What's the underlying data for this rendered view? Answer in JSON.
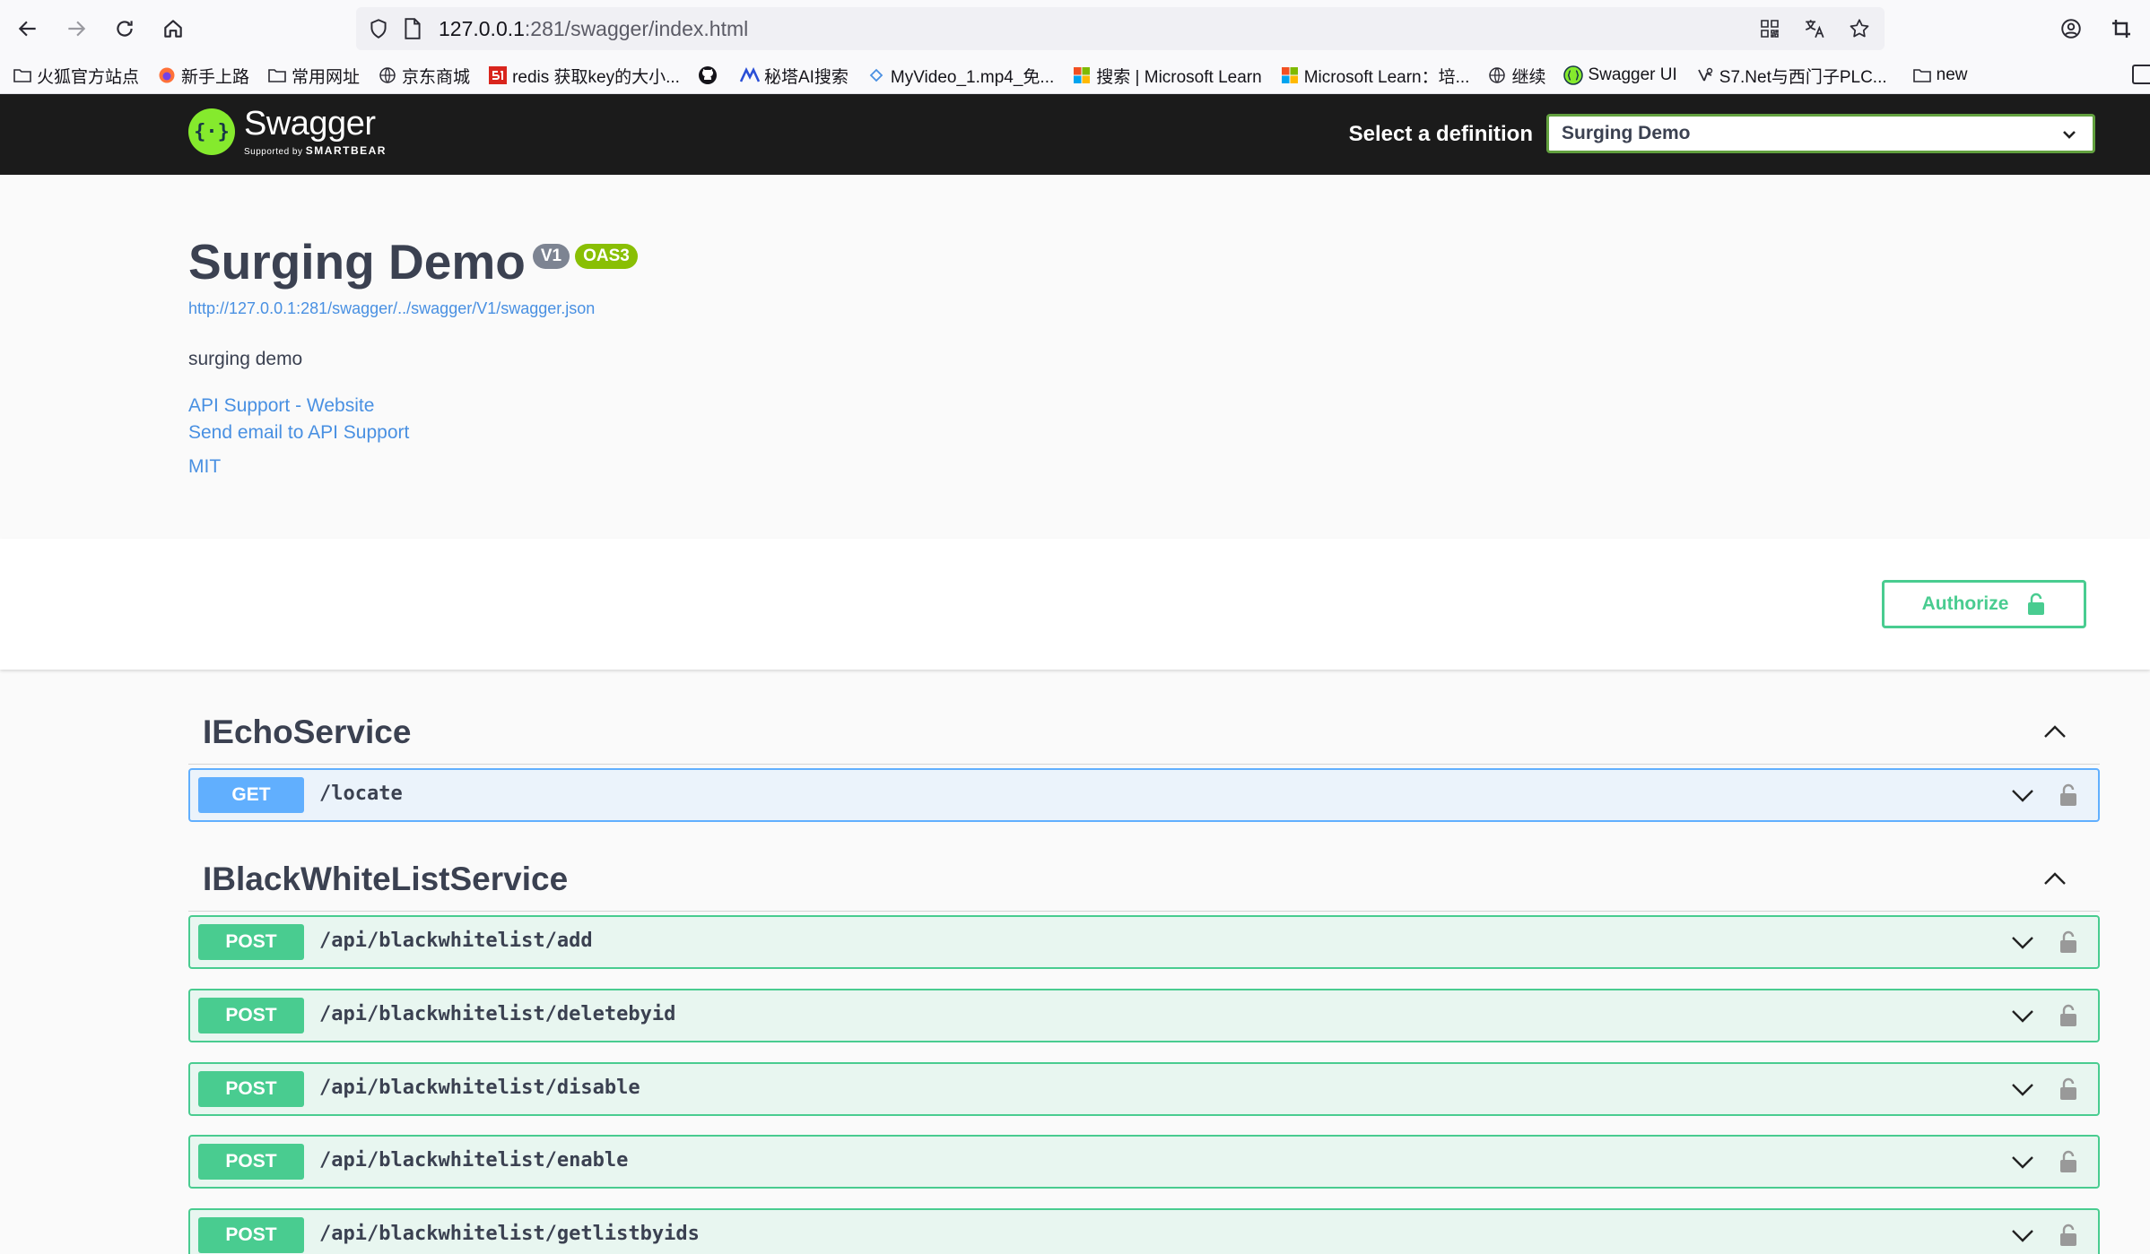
{
  "browser": {
    "url_host": "127.0.0.1",
    "url_rest": ":281/swagger/index.html",
    "bookmarks": [
      {
        "label": "火狐官方站点",
        "icon": "folder-icon"
      },
      {
        "label": "新手上路",
        "icon": "firefox-icon"
      },
      {
        "label": "常用网址",
        "icon": "folder-icon"
      },
      {
        "label": "京东商城",
        "icon": "globe-icon"
      },
      {
        "label": "redis 获取key的大小...",
        "icon": "51cto-icon"
      },
      {
        "label": "",
        "icon": "github-icon"
      },
      {
        "label": "秘塔AI搜索",
        "icon": "metaso-icon"
      },
      {
        "label": "MyVideo_1.mp4_免...",
        "icon": "video-icon"
      },
      {
        "label": "搜索 | Microsoft Learn",
        "icon": "microsoft-icon"
      },
      {
        "label": "Microsoft Learn：培...",
        "icon": "microsoft-icon"
      },
      {
        "label": "继续",
        "icon": "globe-icon"
      },
      {
        "label": "Swagger UI",
        "icon": "swagger-icon"
      },
      {
        "label": "S7.Net与西门子PLC...",
        "icon": "s7-icon"
      },
      {
        "label": "new",
        "icon": "folder-icon"
      }
    ]
  },
  "topbar": {
    "logo_name": "Swagger",
    "logo_sub_supported": "Supported by",
    "logo_sub_brand": "SMARTBEAR",
    "definition_label": "Select a definition",
    "definition_value": "Surging Demo"
  },
  "info": {
    "title": "Surging Demo",
    "version_badge": "V1",
    "oas_badge": "OAS3",
    "spec_url": "http://127.0.0.1:281/swagger/../swagger/V1/swagger.json",
    "description": "surging demo",
    "contact_website": "API Support - Website",
    "contact_email": "Send email to API Support",
    "license": "MIT"
  },
  "authorize_label": "Authorize",
  "colors": {
    "get": "#61affe",
    "post": "#49cc90",
    "topbar": "#1b1b1b",
    "logo": "#85ea2d"
  },
  "tags": [
    {
      "name": "IEchoService",
      "operations": [
        {
          "method": "GET",
          "path": "/locate"
        }
      ]
    },
    {
      "name": "IBlackWhiteListService",
      "operations": [
        {
          "method": "POST",
          "path": "/api/blackwhitelist/add"
        },
        {
          "method": "POST",
          "path": "/api/blackwhitelist/deletebyid"
        },
        {
          "method": "POST",
          "path": "/api/blackwhitelist/disable"
        },
        {
          "method": "POST",
          "path": "/api/blackwhitelist/enable"
        },
        {
          "method": "POST",
          "path": "/api/blackwhitelist/getlistbyids"
        }
      ]
    }
  ]
}
